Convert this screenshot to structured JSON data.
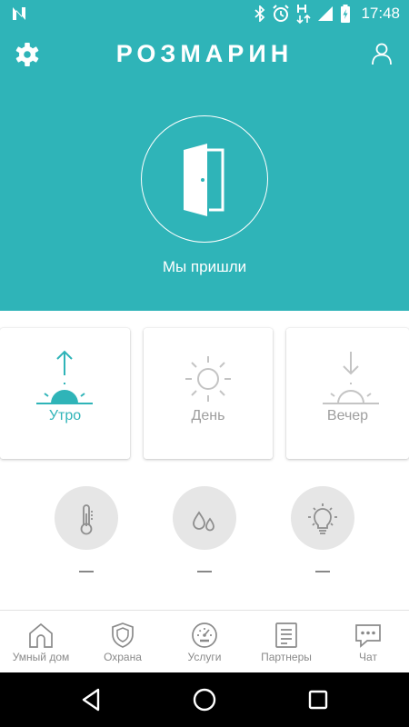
{
  "status_bar": {
    "time": "17:48",
    "icons": [
      "n-logo-icon",
      "bluetooth-icon",
      "alarm-icon",
      "data-h-icon",
      "signal-icon",
      "battery-charging-icon"
    ]
  },
  "header": {
    "title": "РОЗМАРИН",
    "settings_icon": "gear-icon",
    "profile_icon": "user-icon",
    "door_icon": "door-icon",
    "door_label": "Мы пришли",
    "background_color": "#2fb4b8"
  },
  "scenarios": [
    {
      "label": "Утро",
      "icon": "sunrise-icon",
      "active": true
    },
    {
      "label": "День",
      "icon": "sun-icon",
      "active": false
    },
    {
      "label": "Вечер",
      "icon": "sunset-icon",
      "active": false
    }
  ],
  "sensors": [
    {
      "icon": "thermometer-icon",
      "value": "—"
    },
    {
      "icon": "humidity-drops-icon",
      "value": "—"
    },
    {
      "icon": "light-bulb-icon",
      "value": "—"
    }
  ],
  "bottom_nav": [
    {
      "label": "Умный дом",
      "icon": "home-icon"
    },
    {
      "label": "Охрана",
      "icon": "shield-icon"
    },
    {
      "label": "Услуги",
      "icon": "gauge-icon"
    },
    {
      "label": "Партнеры",
      "icon": "document-icon"
    },
    {
      "label": "Чат",
      "icon": "chat-icon"
    }
  ],
  "colors": {
    "accent": "#2fb4b8",
    "inactive": "#9e9e9e",
    "sensor_bg": "#e6e6e6"
  }
}
